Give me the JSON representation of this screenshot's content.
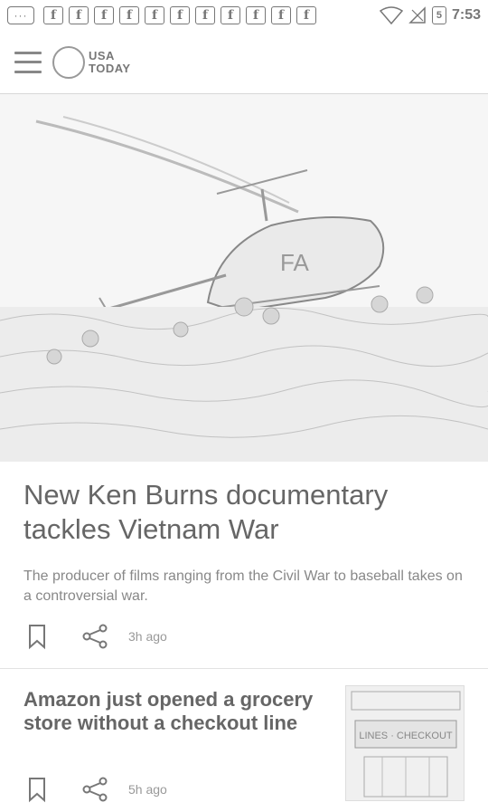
{
  "status_bar": {
    "notification_count": 11,
    "time": "7:53",
    "message_icon": "ellipsis-message-icon",
    "app_icon": "facebook-icon",
    "battery_label": "5"
  },
  "header": {
    "menu_icon": "hamburger-menu-icon",
    "logo_line1": "USA",
    "logo_line2": "TODAY"
  },
  "top_story": {
    "image_alt": "helicopter-in-field",
    "headline": "New Ken Burns documentary tackles Vietnam War",
    "summary": "The producer of films ranging from the Civil War to baseball takes on a controversial war.",
    "timestamp": "3h ago"
  },
  "story2": {
    "headline": "Amazon just opened a grocery store without a checkout line",
    "timestamp": "5h ago"
  }
}
